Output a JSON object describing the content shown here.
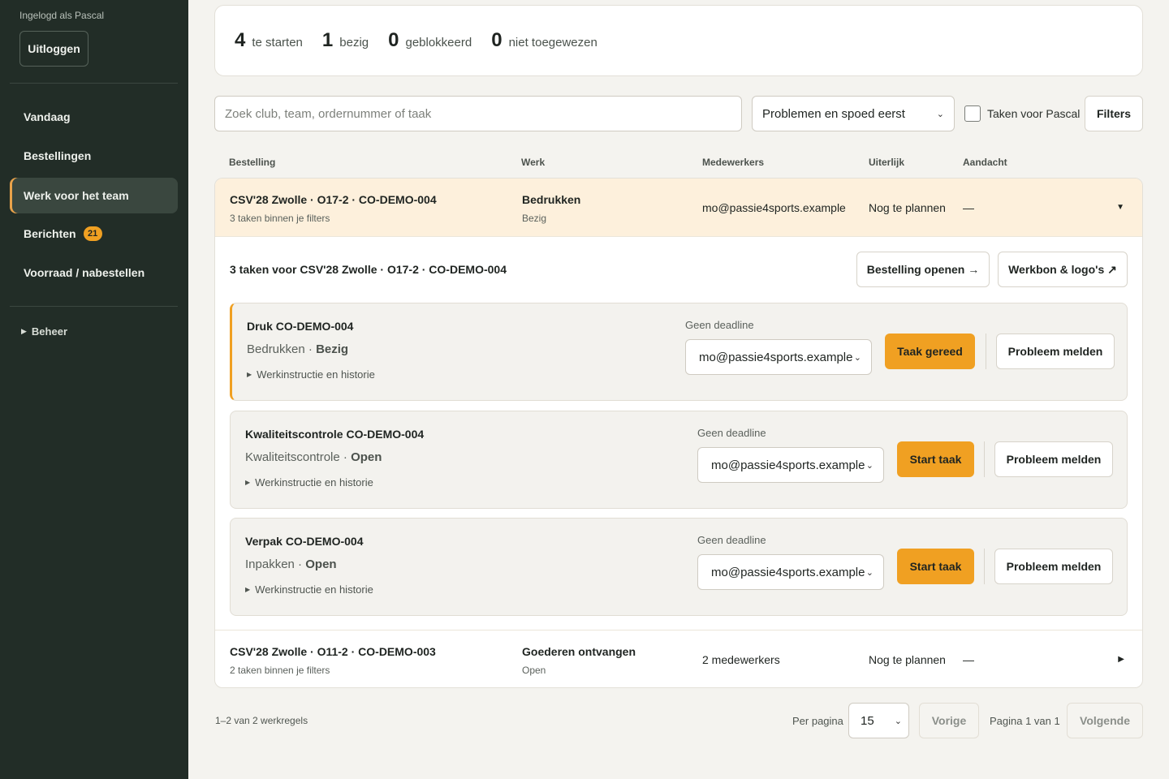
{
  "sidebar": {
    "logged_in": "Ingelogd als Pascal",
    "logout": "Uitloggen",
    "nav": [
      {
        "label": "Vandaag"
      },
      {
        "label": "Bestellingen"
      },
      {
        "label": "Werk voor het team"
      },
      {
        "label": "Berichten",
        "badge": "21"
      },
      {
        "label": "Voorraad / nabestellen"
      }
    ],
    "beheer": "Beheer"
  },
  "stats": [
    {
      "num": "4",
      "label": "te starten"
    },
    {
      "num": "1",
      "label": "bezig"
    },
    {
      "num": "0",
      "label": "geblokkeerd"
    },
    {
      "num": "0",
      "label": "niet toegewezen"
    }
  ],
  "toolbar": {
    "search_placeholder": "Zoek club, team, ordernummer of taak",
    "sort_value": "Problemen en spoed eerst",
    "checkbox_label": "Taken voor Pascal",
    "filters": "Filters"
  },
  "columns": [
    "Bestelling",
    "Werk",
    "Medewerkers",
    "Uiterlijk",
    "Aandacht"
  ],
  "rows": [
    {
      "order": "CSV'28 Zwolle · O17-2 · CO-DEMO-004",
      "sub": "3 taken binnen je filters",
      "work": "Bedrukken",
      "work_status": "Bezig",
      "staff": "mo@passie4sports.example",
      "due": "Nog te plannen",
      "attention": "—"
    },
    {
      "order": "CSV'28 Zwolle · O11-2 · CO-DEMO-003",
      "sub": "2 taken binnen je filters",
      "work": "Goederen ontvangen",
      "work_status": "Open",
      "staff": "2 medewerkers",
      "due": "Nog te plannen",
      "attention": "—"
    }
  ],
  "detail": {
    "title": "3 taken voor CSV'28 Zwolle · O17-2 · CO-DEMO-004",
    "open_order": "Bestelling openen →",
    "workbon": "Werkbon & logo's ↗",
    "tasks": [
      {
        "title": "Druk CO-DEMO-004",
        "stage": "Bedrukken",
        "state": "Bezig",
        "instr": "Werkinstructie en historie",
        "deadline": "Geen deadline",
        "assignee": "mo@passie4sports.example",
        "action": "Taak gereed",
        "problem": "Probleem melden"
      },
      {
        "title": "Kwaliteitscontrole CO-DEMO-004",
        "stage": "Kwaliteitscontrole",
        "state": "Open",
        "instr": "Werkinstructie en historie",
        "deadline": "Geen deadline",
        "assignee": "mo@passie4sports.example",
        "action": "Start taak",
        "problem": "Probleem melden"
      },
      {
        "title": "Verpak CO-DEMO-004",
        "stage": "Inpakken",
        "state": "Open",
        "instr": "Werkinstructie en historie",
        "deadline": "Geen deadline",
        "assignee": "mo@passie4sports.example",
        "action": "Start taak",
        "problem": "Probleem melden"
      }
    ]
  },
  "footer": {
    "count": "1–2 van 2 werkregels",
    "per_page_label": "Per pagina",
    "per_page": "15",
    "prev": "Vorige",
    "page": "Pagina 1 van 1",
    "next": "Volgende"
  },
  "colors": {
    "accent": "#f0a022",
    "sidebar": "#222d27",
    "highlight_row": "#fdf0dc"
  }
}
